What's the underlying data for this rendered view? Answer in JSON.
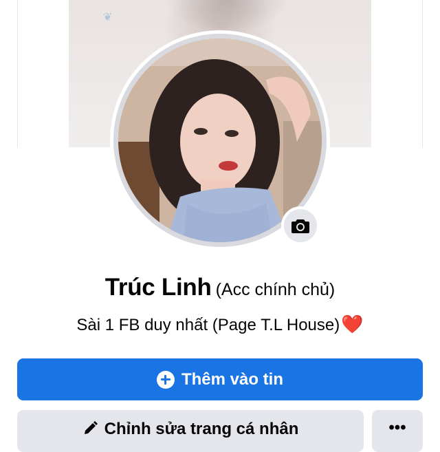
{
  "profile": {
    "name": "Trúc Linh",
    "alias": "(Acc chính chủ)",
    "bio": "Sài 1 FB duy nhất (Page T.L House)",
    "bio_emoji": "❤️"
  },
  "actions": {
    "add_story_label": "Thêm vào tin",
    "edit_profile_label": "Chỉnh sửa trang cá nhân",
    "more_label": "•••"
  },
  "icons": {
    "camera": "camera-icon",
    "plus": "plus-circle-icon",
    "pencil": "pencil-icon",
    "more": "more-dots-icon"
  },
  "colors": {
    "primary": "#1b74e4",
    "secondary_button": "#e4e6eb",
    "text": "#050505"
  }
}
